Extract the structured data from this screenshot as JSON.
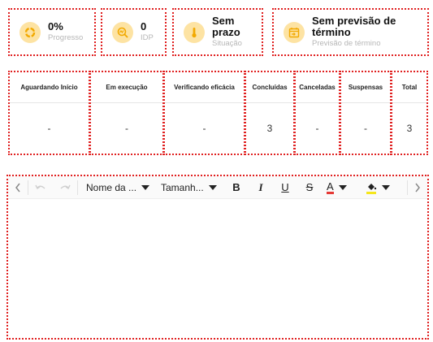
{
  "cards": [
    {
      "value": "0%",
      "label": "Progresso",
      "icon": "progress-ring-icon"
    },
    {
      "value": "0",
      "label": "IDP",
      "icon": "search-chart-icon"
    },
    {
      "value_line1": "Sem",
      "value_line2": "prazo",
      "label": "Situação",
      "icon": "thermometer-icon"
    },
    {
      "value_line1": "Sem previsão de",
      "value_line2": "término",
      "label": "Previsão de término",
      "icon": "calendar-arrow-icon"
    }
  ],
  "status_table": {
    "columns": [
      {
        "header": "Aguardando Início",
        "value": "-"
      },
      {
        "header": "Em execução",
        "value": "-"
      },
      {
        "header": "Verificando eficácia",
        "value": "-"
      },
      {
        "header": "Concluídas",
        "value": "3"
      },
      {
        "header": "Canceladas",
        "value": "-"
      },
      {
        "header": "Suspensas",
        "value": "-"
      },
      {
        "header": "Total",
        "value": "3"
      }
    ]
  },
  "editor": {
    "font_name": "Nome da ...",
    "font_size": "Tamanh...",
    "bold": "B",
    "italic": "I",
    "underline": "U",
    "strike": "S",
    "font_color": "A",
    "font_color_hex": "#e53935",
    "highlight_hex": "#f5e61c"
  },
  "colors": {
    "accent_circle": "#fde3a3",
    "icon": "#f2a900"
  }
}
